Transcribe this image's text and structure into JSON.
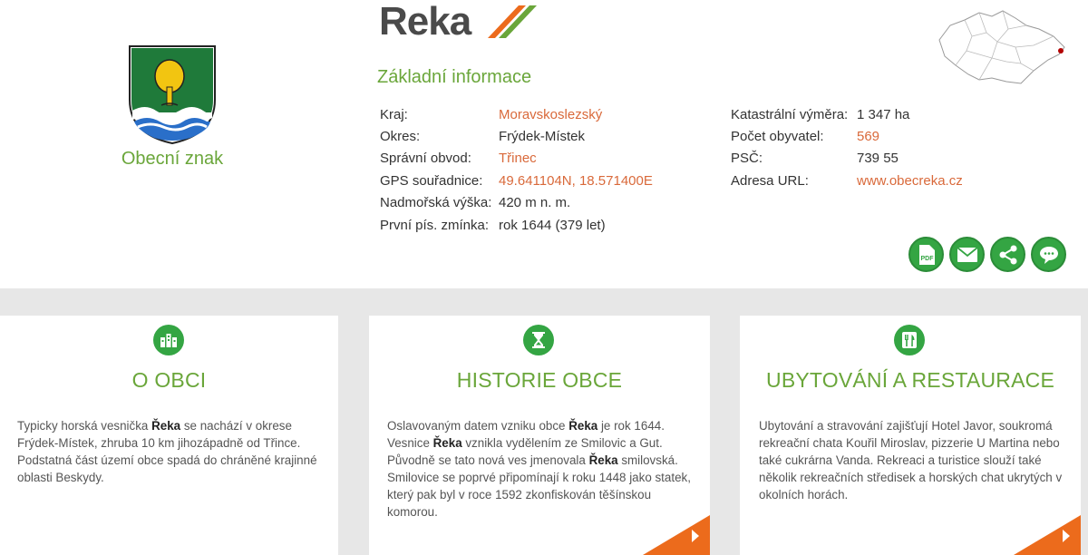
{
  "town": {
    "name": "Řeka",
    "emblem_caption": "Obecní znak"
  },
  "basic_info": {
    "heading": "Základní informace",
    "left": [
      {
        "label": "Kraj:",
        "value": "Moravskoslezský",
        "link": true
      },
      {
        "label": "Okres:",
        "value": "Frýdek-Místek",
        "link": false
      },
      {
        "label": "Správní obvod:",
        "value": "Třinec",
        "link": true
      },
      {
        "label": "GPS souřadnice:",
        "value": "49.641104N, 18.571400E",
        "link": true
      },
      {
        "label": "Nadmořská výška:",
        "value": "420 m n. m.",
        "link": false
      },
      {
        "label": "První pís. zmínka:",
        "value": "rok 1644 (379 let)",
        "link": false
      }
    ],
    "right": [
      {
        "label": "Katastrální výměra:",
        "value": "1 347 ha",
        "link": false
      },
      {
        "label": "Počet obyvatel:",
        "value": "569",
        "link": true
      },
      {
        "label": "PSČ:",
        "value": "739 55",
        "link": false
      },
      {
        "label": "Adresa URL:",
        "value": "www.obecreka.cz",
        "link": true
      }
    ]
  },
  "actions": [
    {
      "name": "pdf-button",
      "icon": "pdf-icon"
    },
    {
      "name": "email-button",
      "icon": "envelope-icon"
    },
    {
      "name": "share-button",
      "icon": "share-icon"
    },
    {
      "name": "comment-button",
      "icon": "speech-bubble-icon"
    }
  ],
  "cards": [
    {
      "title": "O OBCI",
      "icon": "buildings-icon",
      "paragraph_html": "Typicky horská vesnička <b>Řeka</b> se nachází v okrese Frýdek-Místek, zhruba 10 km jihozápadně od Třince. Podstatná část území obce spadá do chráněné krajinné oblasti Beskydy."
    },
    {
      "title": "HISTORIE OBCE",
      "icon": "hourglass-icon",
      "paragraph_html": "Oslavovaným datem vzniku obce <b>Řeka</b> je rok 1644. Vesnice <b>Řeka</b> vznikla vydělením ze Smilovic a Gut. Původně se tato nová ves jmenovala <b>Řeka</b> smilovská. Smilovice se poprvé připomínají k roku 1448 jako statek, který pak byl v roce 1592 zkonfiskován těšínskou komorou."
    },
    {
      "title": "UBYTOVÁNÍ A RESTAURACE",
      "icon": "cutlery-icon",
      "paragraph_html": "Ubytování a stravování zajišťují Hotel Javor, soukromá rekreační chata Kouřil Miroslav, pizzerie U Martina nebo také cukrárna Vanda. Rekreaci a turistice slouží také několik rekreačních středisek a horských chat ukrytých v okolních horách."
    }
  ],
  "colors": {
    "green": "#6aa63a",
    "button_green": "#34a543",
    "link_orange": "#d9693a",
    "corner_orange": "#ec6b1c"
  }
}
